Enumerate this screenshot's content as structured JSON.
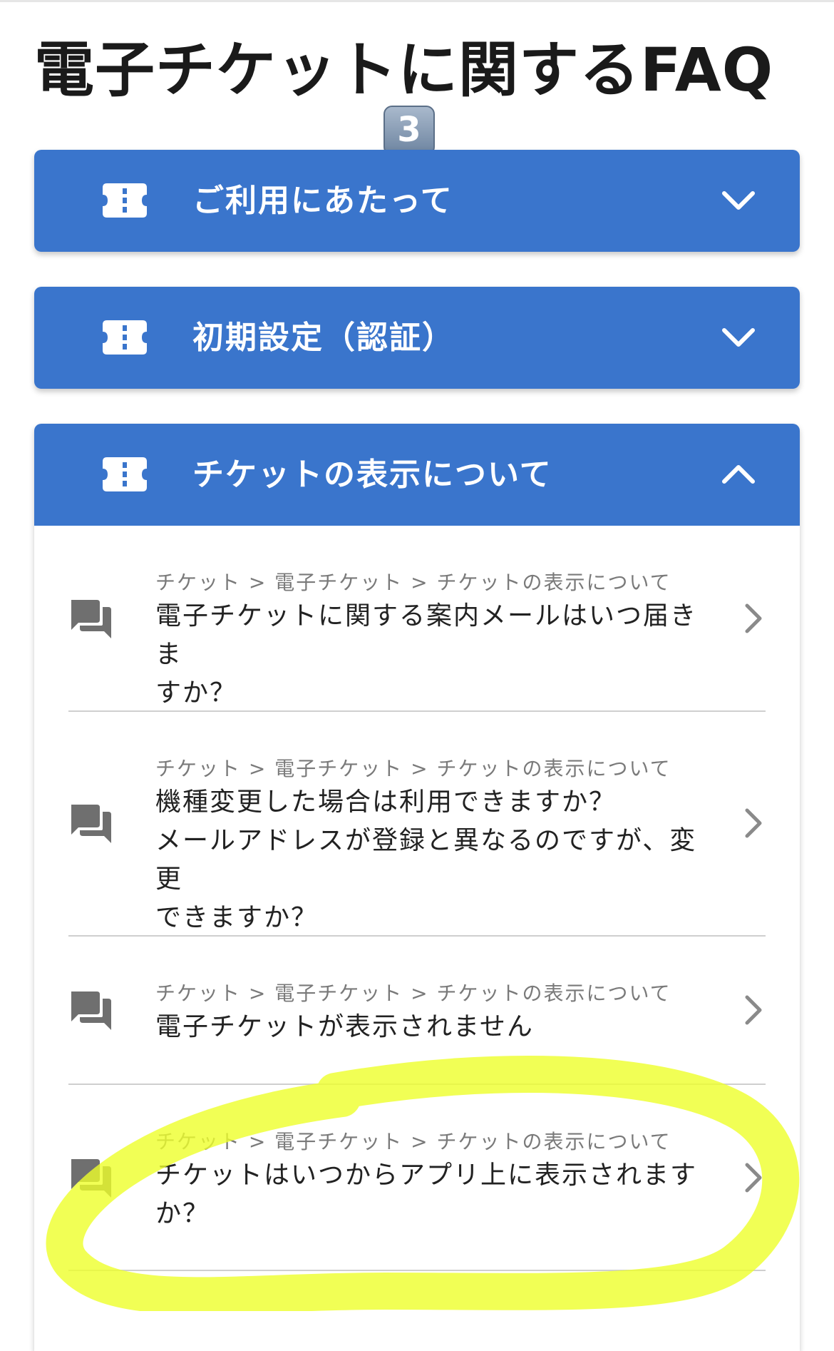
{
  "page": {
    "title": "電子チケットに関するFAQ",
    "badge_number": "3"
  },
  "sections": [
    {
      "label": "ご利用にあたって",
      "expanded": false
    },
    {
      "label": "初期設定（認証）",
      "expanded": false
    },
    {
      "label": "チケットの表示について",
      "expanded": true
    }
  ],
  "faq_items": [
    {
      "breadcrumb": "チケット > 電子チケット > チケットの表示について",
      "question_lines": [
        "電子チケットに関する案内メールはいつ届きま",
        "すか？"
      ]
    },
    {
      "breadcrumb": "チケット > 電子チケット > チケットの表示について",
      "question_lines": [
        "機種変更した場合は利用できますか？",
        "メールアドレスが登録と異なるのですが、変更",
        "できますか？"
      ]
    },
    {
      "breadcrumb": "チケット > 電子チケット > チケットの表示について",
      "question_lines": [
        "電子チケットが表示されません"
      ]
    },
    {
      "breadcrumb": "チケット > 電子チケット > チケットの表示について",
      "question_lines": [
        "チケットはいつからアプリ上に表示されます",
        "か？"
      ]
    }
  ],
  "icons": {
    "section": "ticket-icon",
    "collapsed": "chevron-down-icon",
    "expanded": "chevron-up-icon",
    "faq": "chat-bubbles-icon",
    "faq_arrow": "chevron-right-icon"
  },
  "colors": {
    "header_blue": "#3a75cc",
    "highlight": "#eeff2a",
    "divider": "#cfcfcf",
    "icon_gray": "#6f6f6f"
  }
}
